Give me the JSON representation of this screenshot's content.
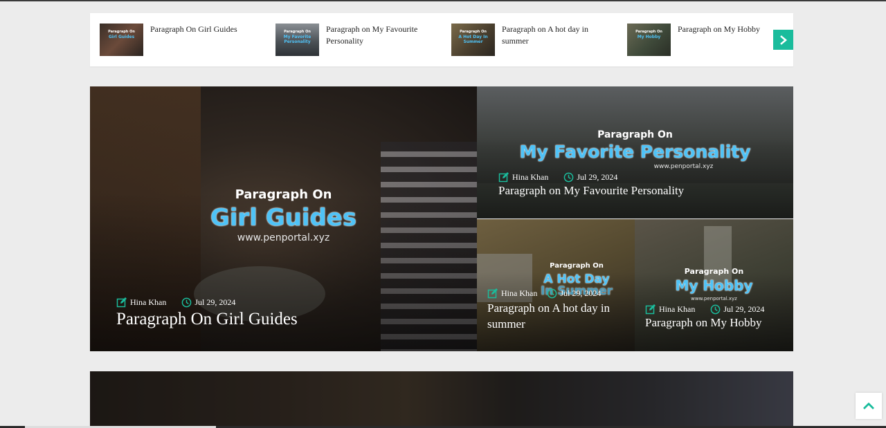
{
  "ticker": {
    "items": [
      {
        "title": "Paragraph On Girl Guides",
        "thumb_line1": "Paragraph On",
        "thumb_line2": "Girl Guides"
      },
      {
        "title": "Paragraph on My Favourite Personality",
        "thumb_line1": "Paragraph On",
        "thumb_line2": "My Favorite Personality"
      },
      {
        "title": "Paragraph on A hot day in summer",
        "thumb_line1": "Paragraph On",
        "thumb_line2": "A Hot Day In Summer"
      },
      {
        "title": "Paragraph on My Hobby",
        "thumb_line1": "Paragraph On",
        "thumb_line2": "My Hobby"
      }
    ],
    "next_icon": "chevron-right-icon"
  },
  "featured": {
    "main": {
      "overlay_line1": "Paragraph On",
      "overlay_line2": "Girl Guides",
      "overlay_site": "www.penportal.xyz",
      "author": "Hina Khan",
      "date": "Jul 29, 2024",
      "title": "Paragraph On Girl Guides"
    },
    "top_right": {
      "overlay_line1": "Paragraph On",
      "overlay_line2": "My Favorite Personality",
      "overlay_site": "www.penportal.xyz",
      "author": "Hina Khan",
      "date": "Jul 29, 2024",
      "title": "Paragraph on My Favourite Personality"
    },
    "bottom_left": {
      "overlay_line1": "Paragraph On",
      "overlay_line2": "A Hot Day",
      "overlay_line3": "In Summer",
      "author": "Hina Khan",
      "date": "Jul 29, 2024",
      "title": "Paragraph on A hot day in summer"
    },
    "bottom_right": {
      "overlay_line1": "Paragraph On",
      "overlay_line2": "My Hobby",
      "overlay_site": "www.penportal.xyz",
      "author": "Hina Khan",
      "date": "Jul 29, 2024",
      "title": "Paragraph on My Hobby"
    }
  },
  "colors": {
    "accent": "#1abc9c",
    "overlay_blue": "#4fc3f7",
    "background": "#ececec"
  },
  "icons": {
    "author": "edit-icon",
    "date": "clock-icon",
    "back_to_top": "chevron-up-icon"
  }
}
